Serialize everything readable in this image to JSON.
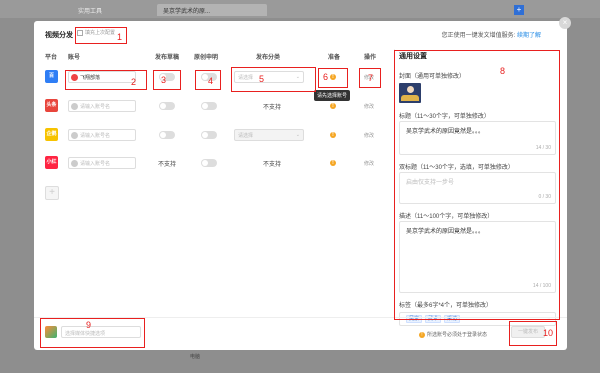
{
  "browser": {
    "tab_tools": "实用工具",
    "tab_article": "吴京学武术的原...",
    "new_tab": "+",
    "bottom_text": "电脑"
  },
  "modal": {
    "title": "视频分发",
    "use_last_label": "填充上次配置",
    "top_tip": "您正使用一键发文增值服务:",
    "top_tip_link": "续期了解",
    "close": "×"
  },
  "columns": {
    "platform": "平台",
    "account": "账号",
    "publish_draft": "发布草稿",
    "original": "原创申明",
    "category": "发布分类",
    "ready": "准备",
    "action": "操作"
  },
  "rows": [
    {
      "platform": "百",
      "platform_color": "#2f7ef5",
      "account": "飞翔部落",
      "account_filled": true,
      "category": "请选择",
      "category_disabled": false,
      "modify": "修改",
      "tooltip": "请先选择账号"
    },
    {
      "platform": "头条",
      "platform_color": "#e8453c",
      "account": "请输入账号名",
      "account_filled": false,
      "category": "不支持",
      "modify": "修改"
    },
    {
      "platform": "企鹅",
      "platform_color": "#f7c300",
      "account": "请输入账号名",
      "account_filled": false,
      "category": "请选择",
      "category_disabled": true,
      "modify": "修改"
    },
    {
      "platform": "小红书",
      "platform_color": "#ff2442",
      "account": "请输入账号名",
      "account_filled": false,
      "draft": "不支持",
      "category": "不支持",
      "modify": "修改"
    }
  ],
  "add_button": "+",
  "panel": {
    "title": "通用设置",
    "cover_label": "封面（通用可单独修改）",
    "title_label": "标题（11～30个字，可单独修改）",
    "title_value": "吴京学武术的原因竟然是。。。",
    "title_count": "14 / 30",
    "subtitle_label": "双标题（11～30个字，选填，可单独修改）",
    "subtitle_placeholder": "启由仅支持一步号",
    "subtitle_count": "0 / 30",
    "desc_label": "描述（11～100个字，可单独修改）",
    "desc_value": "吴京学武术的原因竟然是。。。",
    "desc_count": "14 / 100",
    "tags_label": "标签（最多6字*4个，可单独修改）",
    "tags": [
      "吴京",
      "武术",
      "采访"
    ]
  },
  "footer": {
    "quick_placeholder": "选择媒体快捷选项",
    "warning": "所选账号必须处于登录状态",
    "publish": "一键发布"
  },
  "annotations": [
    "1",
    "2",
    "3",
    "4",
    "5",
    "6",
    "7",
    "8",
    "9",
    "10"
  ],
  "colors": {
    "annotation": "#e8201f",
    "link": "#1e88e5",
    "warning": "#f5a623"
  }
}
